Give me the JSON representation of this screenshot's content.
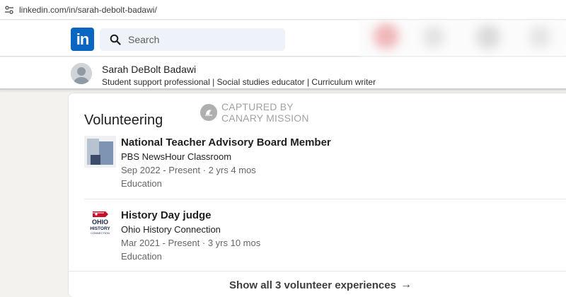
{
  "browser": {
    "url": "linkedin.com/in/sarah-debolt-badawi/"
  },
  "nav": {
    "logo_text": "in",
    "search_placeholder": "Search"
  },
  "profile": {
    "name": "Sarah DeBolt Badawi",
    "headline": "Student support professional | Social studies educator | Curriculum writer"
  },
  "watermark": {
    "line1": "CAPTURED BY",
    "line2": "CANARY MISSION"
  },
  "section": {
    "title": "Volunteering",
    "entries": [
      {
        "title": "National Teacher Advisory Board Member",
        "organization": "PBS NewsHour Classroom",
        "dates": "Sep 2022 - Present · 2 yrs 4 mos",
        "cause": "Education",
        "logo": "pbs-newshour-logo"
      },
      {
        "title": "History Day judge",
        "organization": "Ohio History Connection",
        "dates": "Mar 2021 - Present · 3 yrs 10 mos",
        "cause": "Education",
        "logo": "ohio-history-logo",
        "logo_text": [
          "OHIO",
          "HISTORY",
          "CONNECTION"
        ]
      }
    ],
    "show_all_label": "Show all 3 volunteer experiences"
  },
  "colors": {
    "linkedin_blue": "#0a66c2",
    "search_bg": "#edf3f8",
    "page_bg": "#f4f2ee"
  }
}
